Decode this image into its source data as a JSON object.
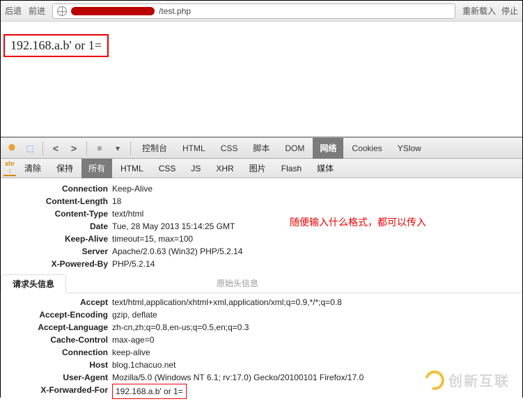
{
  "browser": {
    "back": "后退",
    "forward": "前进",
    "url_tail": "/test.php",
    "reload": "重新载入",
    "stop": "停止"
  },
  "page": {
    "echo_text": "192.168.a.b' or 1="
  },
  "devtools": {
    "top_tabs": {
      "console": "控制台",
      "html": "HTML",
      "css": "CSS",
      "script": "脚本",
      "dom": "DOM",
      "net": "网络",
      "cookies": "Cookies",
      "yslow": "YSlow"
    },
    "sub_tabs": {
      "clear": "清除",
      "persist": "保持",
      "all": "所有",
      "html": "HTML",
      "css": "CSS",
      "js": "JS",
      "xhr": "XHR",
      "images": "图片",
      "flash": "Flash",
      "media": "媒体"
    },
    "response_headers": [
      {
        "name": "Connection",
        "value": "Keep-Alive"
      },
      {
        "name": "Content-Length",
        "value": "18"
      },
      {
        "name": "Content-Type",
        "value": "text/html"
      },
      {
        "name": "Date",
        "value": "Tue, 28 May 2013 15:14:25 GMT"
      },
      {
        "name": "Keep-Alive",
        "value": "timeout=15, max=100"
      },
      {
        "name": "Server",
        "value": "Apache/2.0.63 (Win32) PHP/5.2.14"
      },
      {
        "name": "X-Powered-By",
        "value": "PHP/5.2.14"
      }
    ],
    "section_tabs": {
      "request": "请求头信息",
      "raw": "原始头信息"
    },
    "request_headers": [
      {
        "name": "Accept",
        "value": "text/html,application/xhtml+xml,application/xml;q=0.9,*/*;q=0.8"
      },
      {
        "name": "Accept-Encoding",
        "value": "gzip, deflate"
      },
      {
        "name": "Accept-Language",
        "value": "zh-cn,zh;q=0.8,en-us;q=0.5,en;q=0.3"
      },
      {
        "name": "Cache-Control",
        "value": "max-age=0"
      },
      {
        "name": "Connection",
        "value": "keep-alive"
      },
      {
        "name": "Host",
        "value": "blog.1chacuo.net"
      },
      {
        "name": "User-Agent",
        "value": "Mozilla/5.0 (Windows NT 6.1; rv:17.0) Gecko/20100101 Firefox/17.0"
      },
      {
        "name": "X-Forwarded-For",
        "value": "192.168.a.b' or 1="
      }
    ]
  },
  "annotation": "随便输入什么格式，都可以传入",
  "watermark": "创新互联"
}
